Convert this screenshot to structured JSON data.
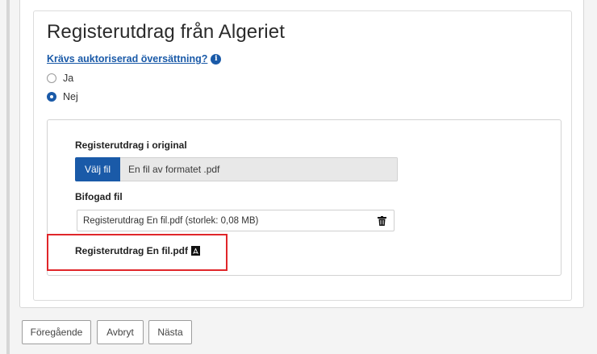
{
  "section": {
    "title": "Registerutdrag från Algeriet",
    "help_link": "Krävs auktoriserad översättning?",
    "info_icon": "i",
    "radio_options": [
      {
        "label": "Ja",
        "checked": false
      },
      {
        "label": "Nej",
        "checked": true
      }
    ]
  },
  "upload": {
    "heading": "Registerutdrag i original",
    "choose_button": "Välj fil",
    "hint": "En fil av formatet .pdf",
    "attached_heading": "Bifogad fil",
    "attached_file": "Registerutdrag En fil.pdf (storlek: 0,08 MB)",
    "download_link": "Registerutdrag En fil.pdf"
  },
  "icons": {
    "info": "info-icon",
    "delete": "trash-icon",
    "file": "pdf-icon"
  },
  "colors": {
    "primary": "#1a5aa8",
    "highlight": "#e0262a"
  },
  "footer": {
    "previous": "Föregående",
    "cancel": "Avbryt",
    "next": "Nästa"
  }
}
